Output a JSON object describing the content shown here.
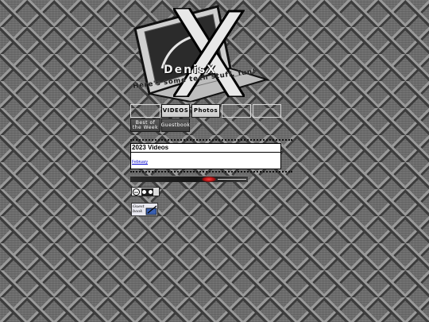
{
  "site": {
    "name": "DenisX",
    "tagline": "Here's some tech stuff, fun!"
  },
  "nav": {
    "videos_label": "VIDEOS",
    "photos_label": "Photos",
    "best_of_week_label_line1": "Best of",
    "best_of_week_label_line2": "the Week",
    "guestbook_label": "Guestbook"
  },
  "videos_panel": {
    "title": "2023 Videos",
    "link_label": "February"
  },
  "guestbook_badge": {
    "line1": "Guest",
    "line2": "book"
  },
  "license": {
    "icon": "creative-commons-badge"
  },
  "colors": {
    "panel_border": "#000000",
    "link": "#0000cc",
    "accent_red": "#ff3b3b"
  }
}
